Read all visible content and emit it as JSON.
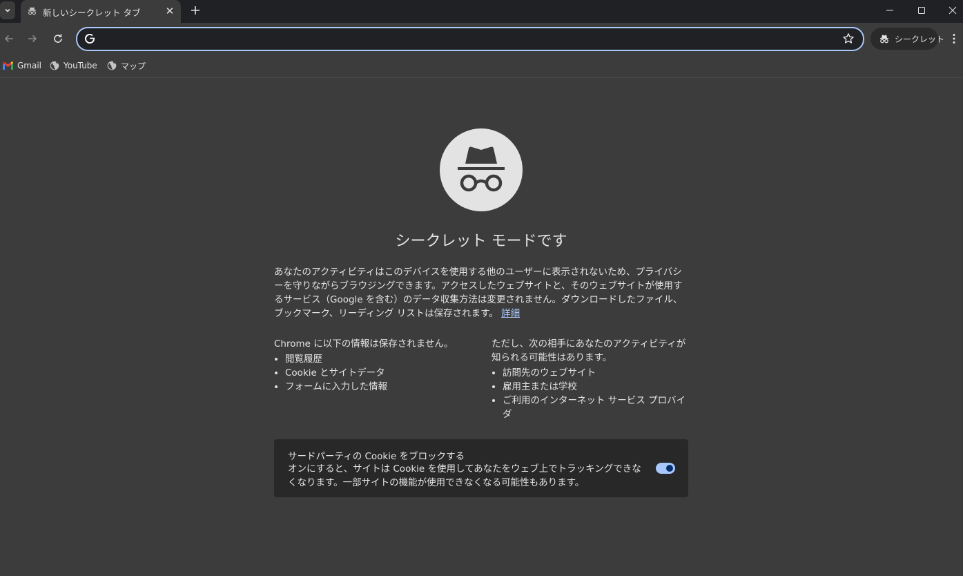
{
  "tabstrip": {
    "search_icon": "chevron-down-icon",
    "tab_title": "新しいシークレット タブ",
    "new_tab_icon": "plus-icon"
  },
  "window_controls": [
    "minimize-icon",
    "maximize-icon",
    "close-icon"
  ],
  "toolbar": {
    "omnibox_value": "",
    "incognito_label": "シークレット"
  },
  "bookmarks": [
    {
      "label": "Gmail",
      "icon": "gmail-icon"
    },
    {
      "label": "YouTube",
      "icon": "globe-icon"
    },
    {
      "label": "マップ",
      "icon": "globe-icon"
    }
  ],
  "content": {
    "heading": "シークレット モードです",
    "intro": "あなたのアクティビティはこのデバイスを使用する他のユーザーに表示されないため、プライバシーを守りながらブラウジングできます。アクセスしたウェブサイトと、そのウェブサイトが使用するサービス（Google を含む）のデータ収集方法は変更されません。ダウンロードしたファイル、ブックマーク、リーディング リストは保存されます。",
    "learn_more": "詳細",
    "not_saved": {
      "title": "Chrome に以下の情報は保存されません。",
      "items": [
        "閲覧履歴",
        "Cookie とサイトデータ",
        "フォームに入力した情報"
      ]
    },
    "visible_to": {
      "title": "ただし、次の相手にあなたのアクティビティが知られる可能性はあります。",
      "items": [
        "訪問先のウェブサイト",
        "雇用主または学校",
        "ご利用のインターネット サービス プロバイダ"
      ]
    },
    "cookie": {
      "title": "サードパーティの Cookie をブロックする",
      "description": "オンにすると、サイトは Cookie を使用してあなたをウェブ上でトラッキングできなくなります。一部サイトの機能が使用できなくなる可能性もあります。",
      "enabled": true
    }
  },
  "colors": {
    "background": "#3c3c3c",
    "tabstrip": "#202124",
    "accent": "#a8c7fa",
    "card": "#282828"
  }
}
